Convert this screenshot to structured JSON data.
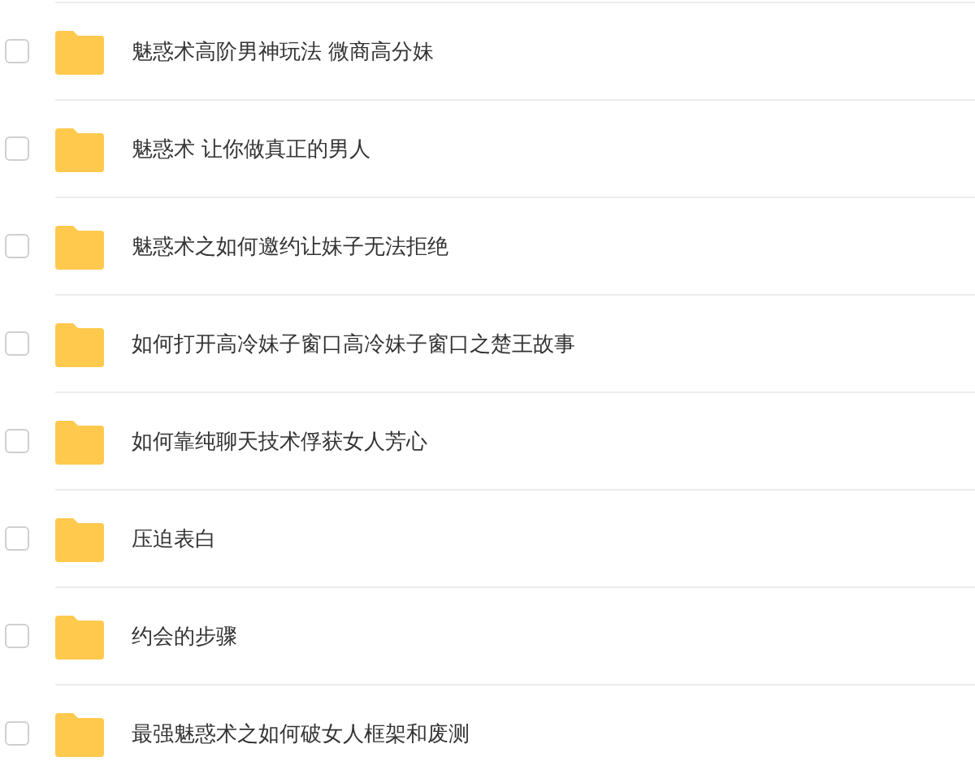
{
  "files": [
    {
      "name": "魅惑术高阶男神玩法 微商高分妹",
      "checked": false
    },
    {
      "name": "魅惑术 让你做真正的男人",
      "checked": false
    },
    {
      "name": "魅惑术之如何邀约让妹子无法拒绝",
      "checked": false
    },
    {
      "name": "如何打开高冷妹子窗口高冷妹子窗口之楚王故事",
      "checked": false
    },
    {
      "name": "如何靠纯聊天技术俘获女人芳心",
      "checked": false
    },
    {
      "name": "压迫表白",
      "checked": false
    },
    {
      "name": "约会的步骤",
      "checked": false
    },
    {
      "name": "最强魅惑术之如何破女人框架和废测",
      "checked": false
    }
  ]
}
